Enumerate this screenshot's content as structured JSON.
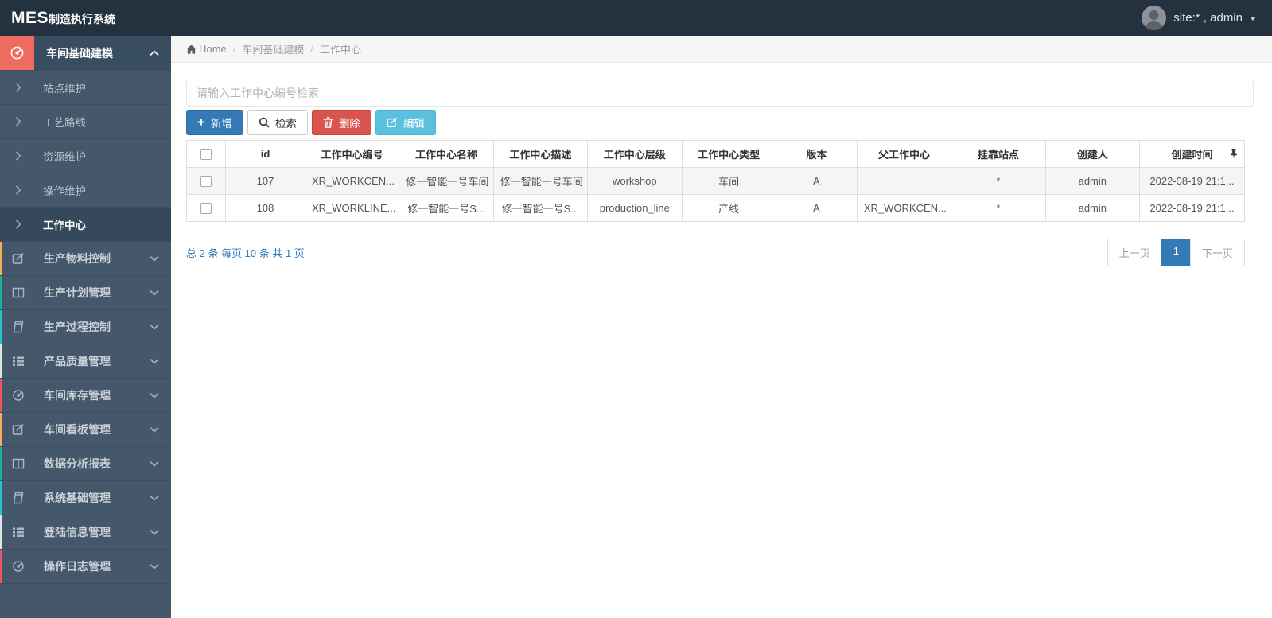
{
  "topbar": {
    "brand_mes": "MES",
    "brand_rest": "制造执行系统",
    "user_label": "site:* , admin"
  },
  "sidebar": {
    "items": [
      {
        "label": "车间基础建模",
        "type": "parent",
        "active": true,
        "icon": "dashboard-icon",
        "icon_block_color": "#ef6d60",
        "chevron": "up"
      },
      {
        "label": "站点维护",
        "type": "sub"
      },
      {
        "label": "工艺路线",
        "type": "sub"
      },
      {
        "label": "资源维护",
        "type": "sub"
      },
      {
        "label": "操作维护",
        "type": "sub"
      },
      {
        "label": "工作中心",
        "type": "sub",
        "active": true
      },
      {
        "label": "生产物料控制",
        "type": "parent",
        "icon": "edit-icon",
        "stripe": "#f8ac59",
        "chevron": "down"
      },
      {
        "label": "生产计划管理",
        "type": "parent",
        "icon": "columns-icon",
        "stripe": "#1ab394",
        "chevron": "down"
      },
      {
        "label": "生产过程控制",
        "type": "parent",
        "icon": "book-icon",
        "stripe": "#23c6c8",
        "chevron": "down"
      },
      {
        "label": "产品质量管理",
        "type": "parent",
        "icon": "list-icon",
        "stripe": "#dfe4e6",
        "chevron": "down"
      },
      {
        "label": "车间库存管理",
        "type": "parent",
        "icon": "dashboard-icon",
        "stripe": "#ed5565",
        "chevron": "down"
      },
      {
        "label": "车间看板管理",
        "type": "parent",
        "icon": "edit-icon",
        "stripe": "#f8ac59",
        "chevron": "down"
      },
      {
        "label": "数据分析报表",
        "type": "parent",
        "icon": "columns-icon",
        "stripe": "#1ab394",
        "chevron": "down"
      },
      {
        "label": "系统基础管理",
        "type": "parent",
        "icon": "book-icon",
        "stripe": "#23c6c8",
        "chevron": "down"
      },
      {
        "label": "登陆信息管理",
        "type": "parent",
        "icon": "list-icon",
        "stripe": "#dfe4e6",
        "chevron": "down"
      },
      {
        "label": "操作日志管理",
        "type": "parent",
        "icon": "dashboard-icon",
        "stripe": "#ed5565",
        "chevron": "down"
      }
    ]
  },
  "breadcrumb": {
    "home": "Home",
    "level1": "车间基础建模",
    "level2": "工作中心"
  },
  "toolbar": {
    "search_placeholder": "请输入工作中心编号检索",
    "add_label": "新增",
    "search_label": "检索",
    "delete_label": "删除",
    "edit_label": "编辑"
  },
  "table": {
    "columns": [
      "id",
      "工作中心编号",
      "工作中心名称",
      "工作中心描述",
      "工作中心层级",
      "工作中心类型",
      "版本",
      "父工作中心",
      "挂靠站点",
      "创建人",
      "创建时间"
    ],
    "rows": [
      [
        "107",
        "XR_WORKCEN...",
        "修一智能一号车间",
        "修一智能一号车间",
        "workshop",
        "车间",
        "A",
        "",
        "*",
        "admin",
        "2022-08-19 21:1..."
      ],
      [
        "108",
        "XR_WORKLINE...",
        "修一智能一号S...",
        "修一智能一号S...",
        "production_line",
        "产线",
        "A",
        "XR_WORKCEN...",
        "*",
        "admin",
        "2022-08-19 21:1..."
      ]
    ]
  },
  "pagination": {
    "summary": "总 2 条 每页 10 条 共 1 页",
    "prev_label": "上一页",
    "current_page": "1",
    "next_label": "下一页"
  },
  "colors": {
    "topbar_bg": "#243240",
    "sidebar_bg": "#45576a",
    "active_icon_block": "#ef6d60",
    "primary_btn": "#337ab7",
    "danger_btn": "#d9534f",
    "info_btn": "#5bc0de",
    "link_blue": "#337ab7"
  }
}
